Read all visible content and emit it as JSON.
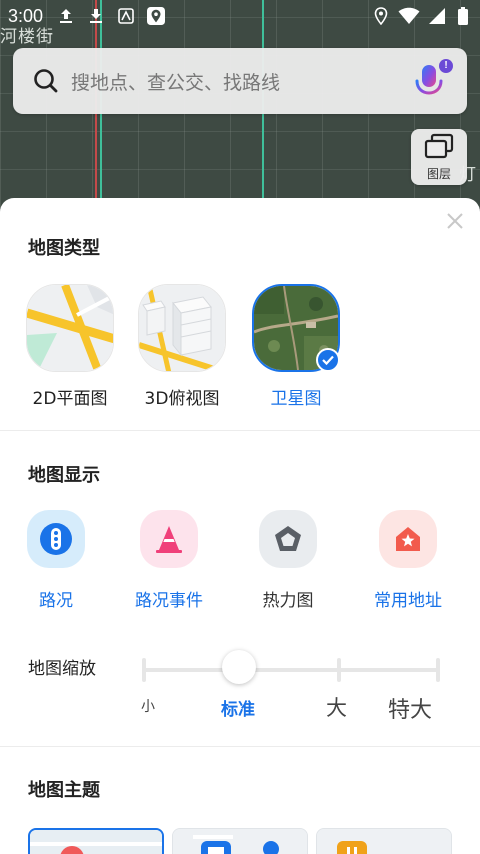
{
  "status_bar": {
    "time": "3:00"
  },
  "map": {
    "street_text": "河楼街",
    "edge_text": "灯"
  },
  "search": {
    "placeholder": "搜地点、查公交、找路线",
    "badge": "!"
  },
  "layer_button": {
    "label": "图层"
  },
  "sheet": {
    "map_type": {
      "title": "地图类型",
      "items": [
        {
          "label": "2D平面图",
          "selected": false
        },
        {
          "label": "3D俯视图",
          "selected": false
        },
        {
          "label": "卫星图",
          "selected": true
        }
      ]
    },
    "map_display": {
      "title": "地图显示",
      "items": [
        {
          "label": "路况",
          "active": true,
          "icon": "traffic-light-icon"
        },
        {
          "label": "路况事件",
          "active": true,
          "icon": "traffic-cone-icon"
        },
        {
          "label": "热力图",
          "active": false,
          "icon": "pentagon-icon"
        },
        {
          "label": "常用地址",
          "active": true,
          "icon": "home-star-icon"
        }
      ]
    },
    "map_zoom": {
      "title": "地图缩放",
      "options": [
        "小",
        "标准",
        "大",
        "特大"
      ],
      "selected": "标准"
    },
    "map_theme": {
      "title": "地图主题"
    }
  },
  "colors": {
    "accent": "#1a73e8",
    "traffic_icon_bg": "#d6ecfb",
    "cone_icon_bg": "#fde3ec",
    "heat_icon_bg": "#e9ecef",
    "home_icon_bg": "#fde5e3"
  }
}
